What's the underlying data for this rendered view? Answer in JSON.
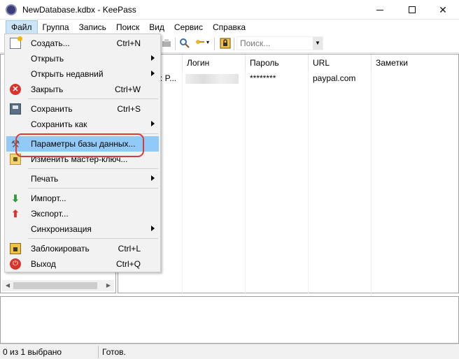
{
  "window": {
    "title": "NewDatabase.kdbx - KeePass"
  },
  "menubar": [
    "Файл",
    "Группа",
    "Запись",
    "Поиск",
    "Вид",
    "Сервис",
    "Справка"
  ],
  "toolbar": {
    "search_placeholder": "Поиск..."
  },
  "file_menu": {
    "items": [
      {
        "label": "Создать...",
        "shortcut": "Ctrl+N",
        "icon": "new-database-icon"
      },
      {
        "label": "Открыть",
        "submenu": true
      },
      {
        "label": "Открыть недавний",
        "submenu": true
      },
      {
        "label": "Закрыть",
        "shortcut": "Ctrl+W",
        "icon": "close-icon"
      },
      {
        "label": "Сохранить",
        "shortcut": "Ctrl+S",
        "icon": "save-icon"
      },
      {
        "label": "Сохранить как",
        "submenu": true
      },
      {
        "label": "Параметры базы данных...",
        "icon": "wrench-icon",
        "highlighted": true
      },
      {
        "label": "Изменить мастер-ключ...",
        "icon": "key-icon"
      },
      {
        "label": "Печать",
        "submenu": true
      },
      {
        "label": "Импорт...",
        "icon": "import-icon"
      },
      {
        "label": "Экспорт...",
        "icon": "export-icon"
      },
      {
        "label": "Синхронизация",
        "submenu": true
      },
      {
        "label": "Заблокировать",
        "shortcut": "Ctrl+L",
        "icon": "lock-icon"
      },
      {
        "label": "Выход",
        "shortcut": "Ctrl+Q",
        "icon": "exit-icon"
      }
    ]
  },
  "entries": {
    "columns": [
      "Логин",
      "Пароль",
      "URL",
      "Заметки"
    ],
    "rows": [
      {
        "title_fragment": ": P...",
        "password": "********",
        "url": "paypal.com"
      }
    ]
  },
  "status": {
    "selection": "0 из 1 выбрано",
    "state": "Готов."
  },
  "colors": {
    "highlight": "#91c9f7",
    "annotation_ring": "#d93a3a"
  }
}
